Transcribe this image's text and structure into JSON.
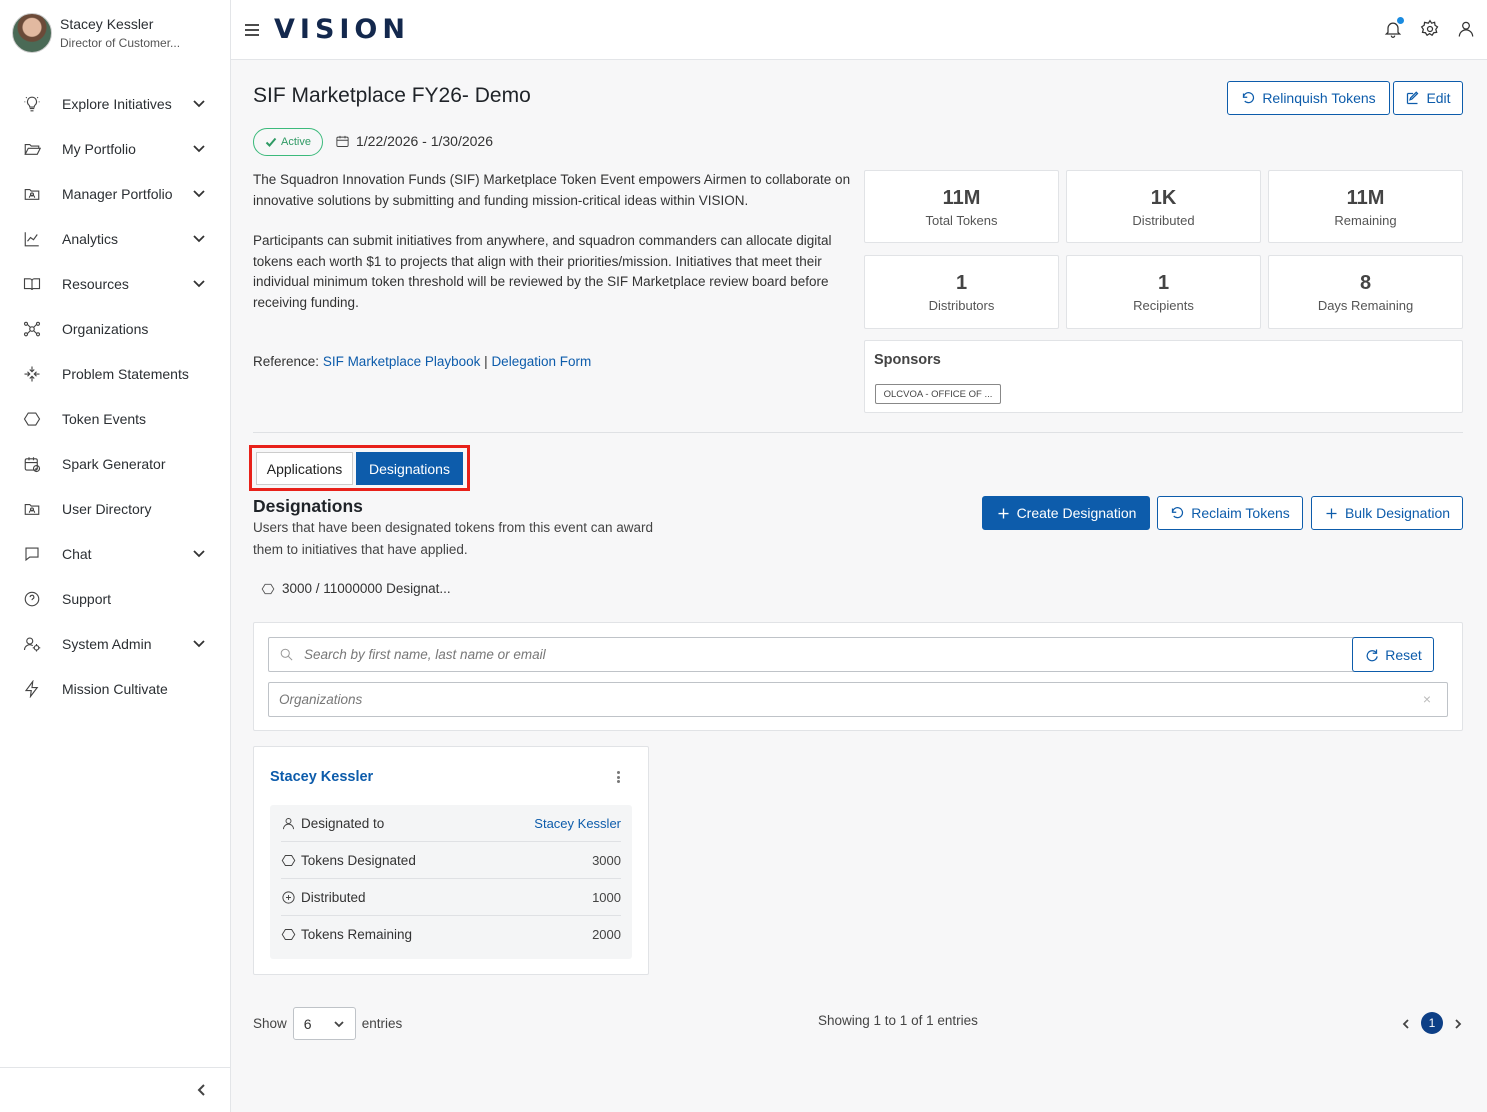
{
  "user": {
    "name": "Stacey Kessler",
    "role": "Director of Customer..."
  },
  "sidebar": {
    "items": [
      {
        "label": "Explore Initiatives",
        "icon": "lightbulb-icon"
      },
      {
        "label": "My Portfolio",
        "icon": "folder-open-icon"
      },
      {
        "label": "Manager Portfolio",
        "icon": "folder-user-icon"
      },
      {
        "label": "Analytics",
        "icon": "line-chart-icon"
      },
      {
        "label": "Resources",
        "icon": "book-open-icon"
      },
      {
        "label": "Organizations",
        "icon": "network-icon"
      },
      {
        "label": "Problem Statements",
        "icon": "arrows-in-icon"
      },
      {
        "label": "Token Events",
        "icon": "hexagon-icon"
      },
      {
        "label": "Spark Generator",
        "icon": "calendar-check-icon"
      },
      {
        "label": "User Directory",
        "icon": "id-card-icon"
      },
      {
        "label": "Chat",
        "icon": "chat-icon"
      },
      {
        "label": "Support",
        "icon": "help-circle-icon"
      },
      {
        "label": "System Admin",
        "icon": "users-gear-icon"
      },
      {
        "label": "Mission Cultivate",
        "icon": "bolt-icon"
      }
    ]
  },
  "header": {
    "logo": "VISION"
  },
  "event": {
    "title": "SIF Marketplace FY26- Demo",
    "status": "Active",
    "dates": "1/22/2026 - 1/30/2026",
    "description": [
      "The Squadron Innovation Funds (SIF) Marketplace Token Event empowers Airmen to collaborate on innovative solutions by submitting and funding mission-critical ideas within VISION.",
      "Participants can submit initiatives from anywhere, and squadron commanders can allocate digital tokens each worth $1 to projects that align with their priorities/mission. Initiatives that meet their individual minimum token threshold will be reviewed by the SIF Marketplace review board before receiving funding."
    ],
    "reference_label": "Reference:",
    "reference_link1": "SIF Marketplace Playbook",
    "reference_sep": "|",
    "reference_link2": "Delegation Form",
    "relinquish_label": "Relinquish Tokens",
    "edit_label": "Edit"
  },
  "stats": [
    {
      "value": "11M",
      "label": "Total Tokens"
    },
    {
      "value": "1K",
      "label": "Distributed"
    },
    {
      "value": "11M",
      "label": "Remaining"
    },
    {
      "value": "1",
      "label": "Distributors"
    },
    {
      "value": "1",
      "label": "Recipients"
    },
    {
      "value": "8",
      "label": "Days Remaining"
    }
  ],
  "sponsors": {
    "title": "Sponsors",
    "chip": "OLCVOA - OFFICE OF ..."
  },
  "tabs": {
    "applications": "Applications",
    "designations": "Designations"
  },
  "designations": {
    "title": "Designations",
    "description": "Users that have been designated tokens from this event can award them to initiatives that have applied.",
    "create_label": "Create Designation",
    "reclaim_label": "Reclaim Tokens",
    "bulk_label": "Bulk Designation",
    "progress": "3000 / 11000000 Designat...",
    "search_placeholder": "Search by first name, last name or email",
    "orgs_placeholder": "Organizations",
    "reset_label": "Reset",
    "clear_symbol": "×"
  },
  "card": {
    "title": "Stacey Kessler",
    "rows": [
      {
        "label": "Designated to",
        "value": "Stacey Kessler"
      },
      {
        "label": "Tokens Designated",
        "value": "3000"
      },
      {
        "label": "Distributed",
        "value": "1000"
      },
      {
        "label": "Tokens Remaining",
        "value": "2000"
      }
    ]
  },
  "pagination": {
    "show_label": "Show",
    "page_size": "6",
    "entries_label": "entries",
    "summary": "Showing 1 to 1 of 1 entries",
    "current_page": "1"
  },
  "colors": {
    "primary": "#0d5cab",
    "active_green": "#3cba7c",
    "highlight_red": "#e8211a",
    "logo_navy": "#13284d"
  }
}
